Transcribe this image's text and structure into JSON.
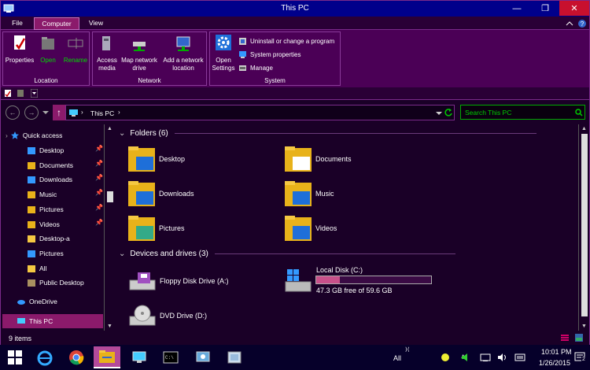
{
  "window": {
    "title": "This PC",
    "minimize": "—",
    "maximize": "❐",
    "close": "✕"
  },
  "tabs": [
    {
      "label": "File"
    },
    {
      "label": "Computer"
    },
    {
      "label": "View"
    }
  ],
  "ribbon": {
    "location": {
      "label": "Location",
      "properties": "Properties",
      "open": "Open",
      "rename": "Rename"
    },
    "network": {
      "label": "Network",
      "access_media_1": "Access",
      "access_media_2": "media",
      "map_drive_1": "Map network",
      "map_drive_2": "drive",
      "add_location_1": "Add a network",
      "add_location_2": "location"
    },
    "system": {
      "label": "System",
      "open_settings_1": "Open",
      "open_settings_2": "Settings",
      "uninstall": "Uninstall or change a program",
      "sys_props": "System properties",
      "manage": "Manage"
    }
  },
  "address": {
    "path": "This PC",
    "separator": "›",
    "search_placeholder": "Search This PC"
  },
  "nav": {
    "quick_access": "Quick access",
    "items": [
      {
        "label": "Desktop",
        "pinned": true
      },
      {
        "label": "Documents",
        "pinned": true
      },
      {
        "label": "Downloads",
        "pinned": true
      },
      {
        "label": "Music",
        "pinned": true
      },
      {
        "label": "Pictures",
        "pinned": true
      },
      {
        "label": "Videos",
        "pinned": true
      },
      {
        "label": "Desktop-a",
        "pinned": false
      },
      {
        "label": "Pictures",
        "pinned": false
      },
      {
        "label": "All",
        "pinned": false
      },
      {
        "label": "Public Desktop",
        "pinned": false
      }
    ],
    "onedrive": "OneDrive",
    "this_pc": "This PC"
  },
  "folders": {
    "header": "Folders (6)",
    "items": [
      {
        "label": "Desktop"
      },
      {
        "label": "Documents"
      },
      {
        "label": "Downloads"
      },
      {
        "label": "Music"
      },
      {
        "label": "Pictures"
      },
      {
        "label": "Videos"
      }
    ]
  },
  "drives": {
    "header": "Devices and drives (3)",
    "floppy": "Floppy Disk Drive (A:)",
    "local": {
      "label": "Local Disk (C:)",
      "free": "47.3 GB free of 59.6 GB",
      "used_fraction": 0.206
    },
    "dvd": "DVD Drive (D:)"
  },
  "status": {
    "count": "9 items"
  },
  "taskbar": {
    "all": "All",
    "time": "10:01 PM",
    "date": "1/26/2015",
    "notification_badge": "2"
  },
  "colors": {
    "accent": "#8b1a6b",
    "title": "#00008b",
    "search": "#00cc00",
    "folder": "#e8b21a"
  }
}
